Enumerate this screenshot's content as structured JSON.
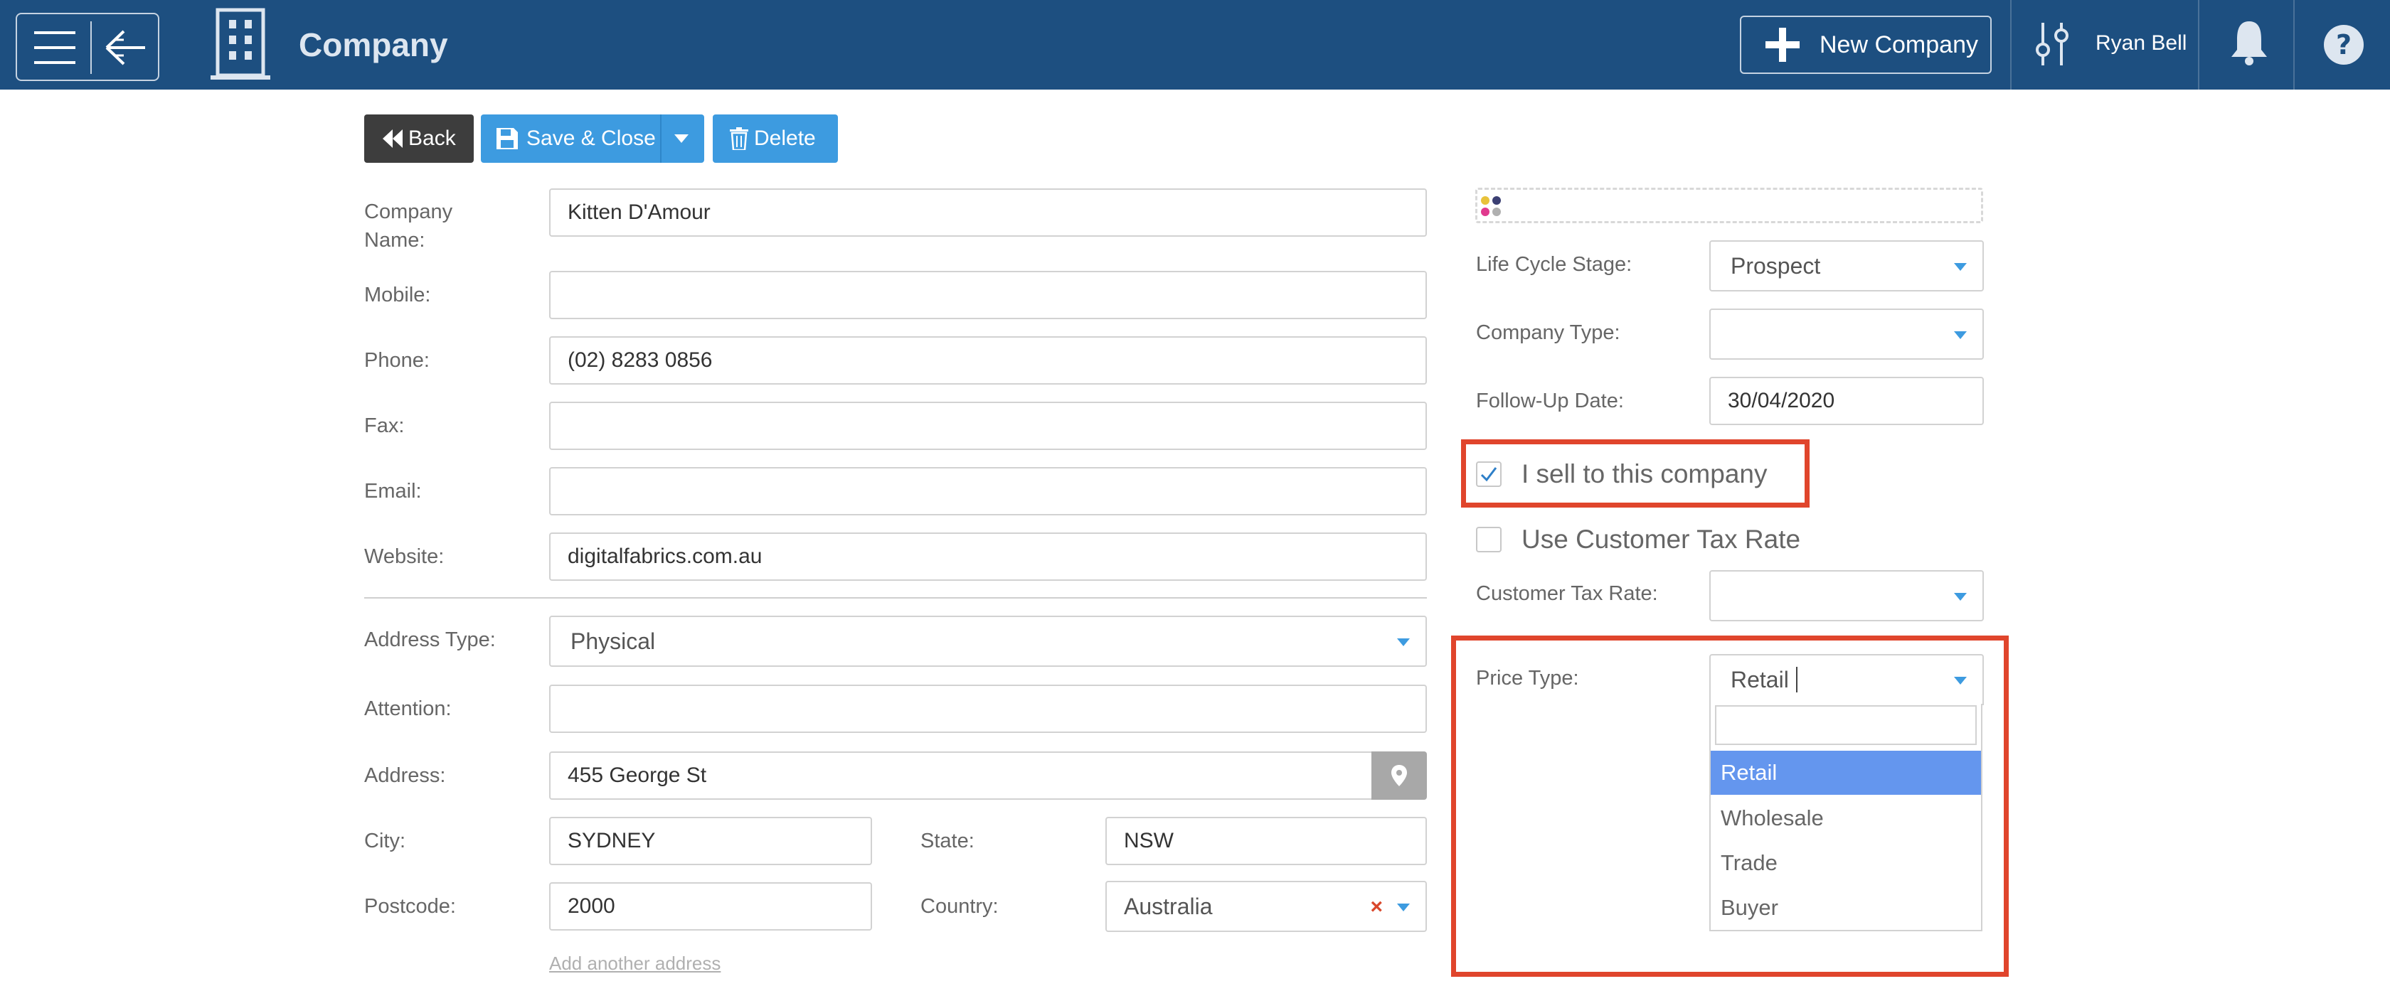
{
  "header": {
    "title": "Company",
    "new_company_label": "New Company",
    "user_name": "Ryan Bell"
  },
  "toolbar": {
    "back_label": "Back",
    "save_label": "Save & Close",
    "delete_label": "Delete"
  },
  "form": {
    "company_name": {
      "label": "Company Name:",
      "value": "Kitten D'Amour"
    },
    "mobile": {
      "label": "Mobile:",
      "value": ""
    },
    "phone": {
      "label": "Phone:",
      "value": "(02) 8283 0856"
    },
    "fax": {
      "label": "Fax:",
      "value": ""
    },
    "email": {
      "label": "Email:",
      "value": ""
    },
    "website": {
      "label": "Website:",
      "value": "digitalfabrics.com.au"
    },
    "address_type": {
      "label": "Address Type:",
      "value": "Physical"
    },
    "attention": {
      "label": "Attention:",
      "value": ""
    },
    "address": {
      "label": "Address:",
      "value": "455 George St"
    },
    "city": {
      "label": "City:",
      "value": "SYDNEY"
    },
    "state": {
      "label": "State:",
      "value": "NSW"
    },
    "postcode": {
      "label": "Postcode:",
      "value": "2000"
    },
    "country": {
      "label": "Country:",
      "value": "Australia"
    },
    "add_address_link": "Add another address"
  },
  "right": {
    "life_cycle_stage": {
      "label": "Life Cycle Stage:",
      "value": "Prospect"
    },
    "company_type": {
      "label": "Company Type:",
      "value": ""
    },
    "follow_up_date": {
      "label": "Follow-Up Date:",
      "value": "30/04/2020"
    },
    "sell_to_company": {
      "label": "I sell to this company",
      "checked": true
    },
    "use_customer_tax_rate": {
      "label": "Use Customer Tax Rate",
      "checked": false
    },
    "customer_tax_rate": {
      "label": "Customer Tax Rate:",
      "value": ""
    },
    "price_type": {
      "label": "Price Type:",
      "value": "Retail",
      "options": [
        "Retail",
        "Wholesale",
        "Trade",
        "Buyer"
      ],
      "selected_index": 0
    }
  },
  "colors": {
    "header_bg": "#1d4f80",
    "primary": "#3d9be0",
    "back_button": "#3d3d3d",
    "highlight": "#e0452c",
    "selected_option": "#6496ee"
  },
  "icons": [
    "hamburger-icon",
    "back-arrow-icon",
    "building-icon",
    "plus-icon",
    "sliders-icon",
    "bell-icon",
    "help-icon",
    "rewind-icon",
    "save-icon",
    "trash-icon",
    "map-pin-icon",
    "checkmark-icon"
  ]
}
